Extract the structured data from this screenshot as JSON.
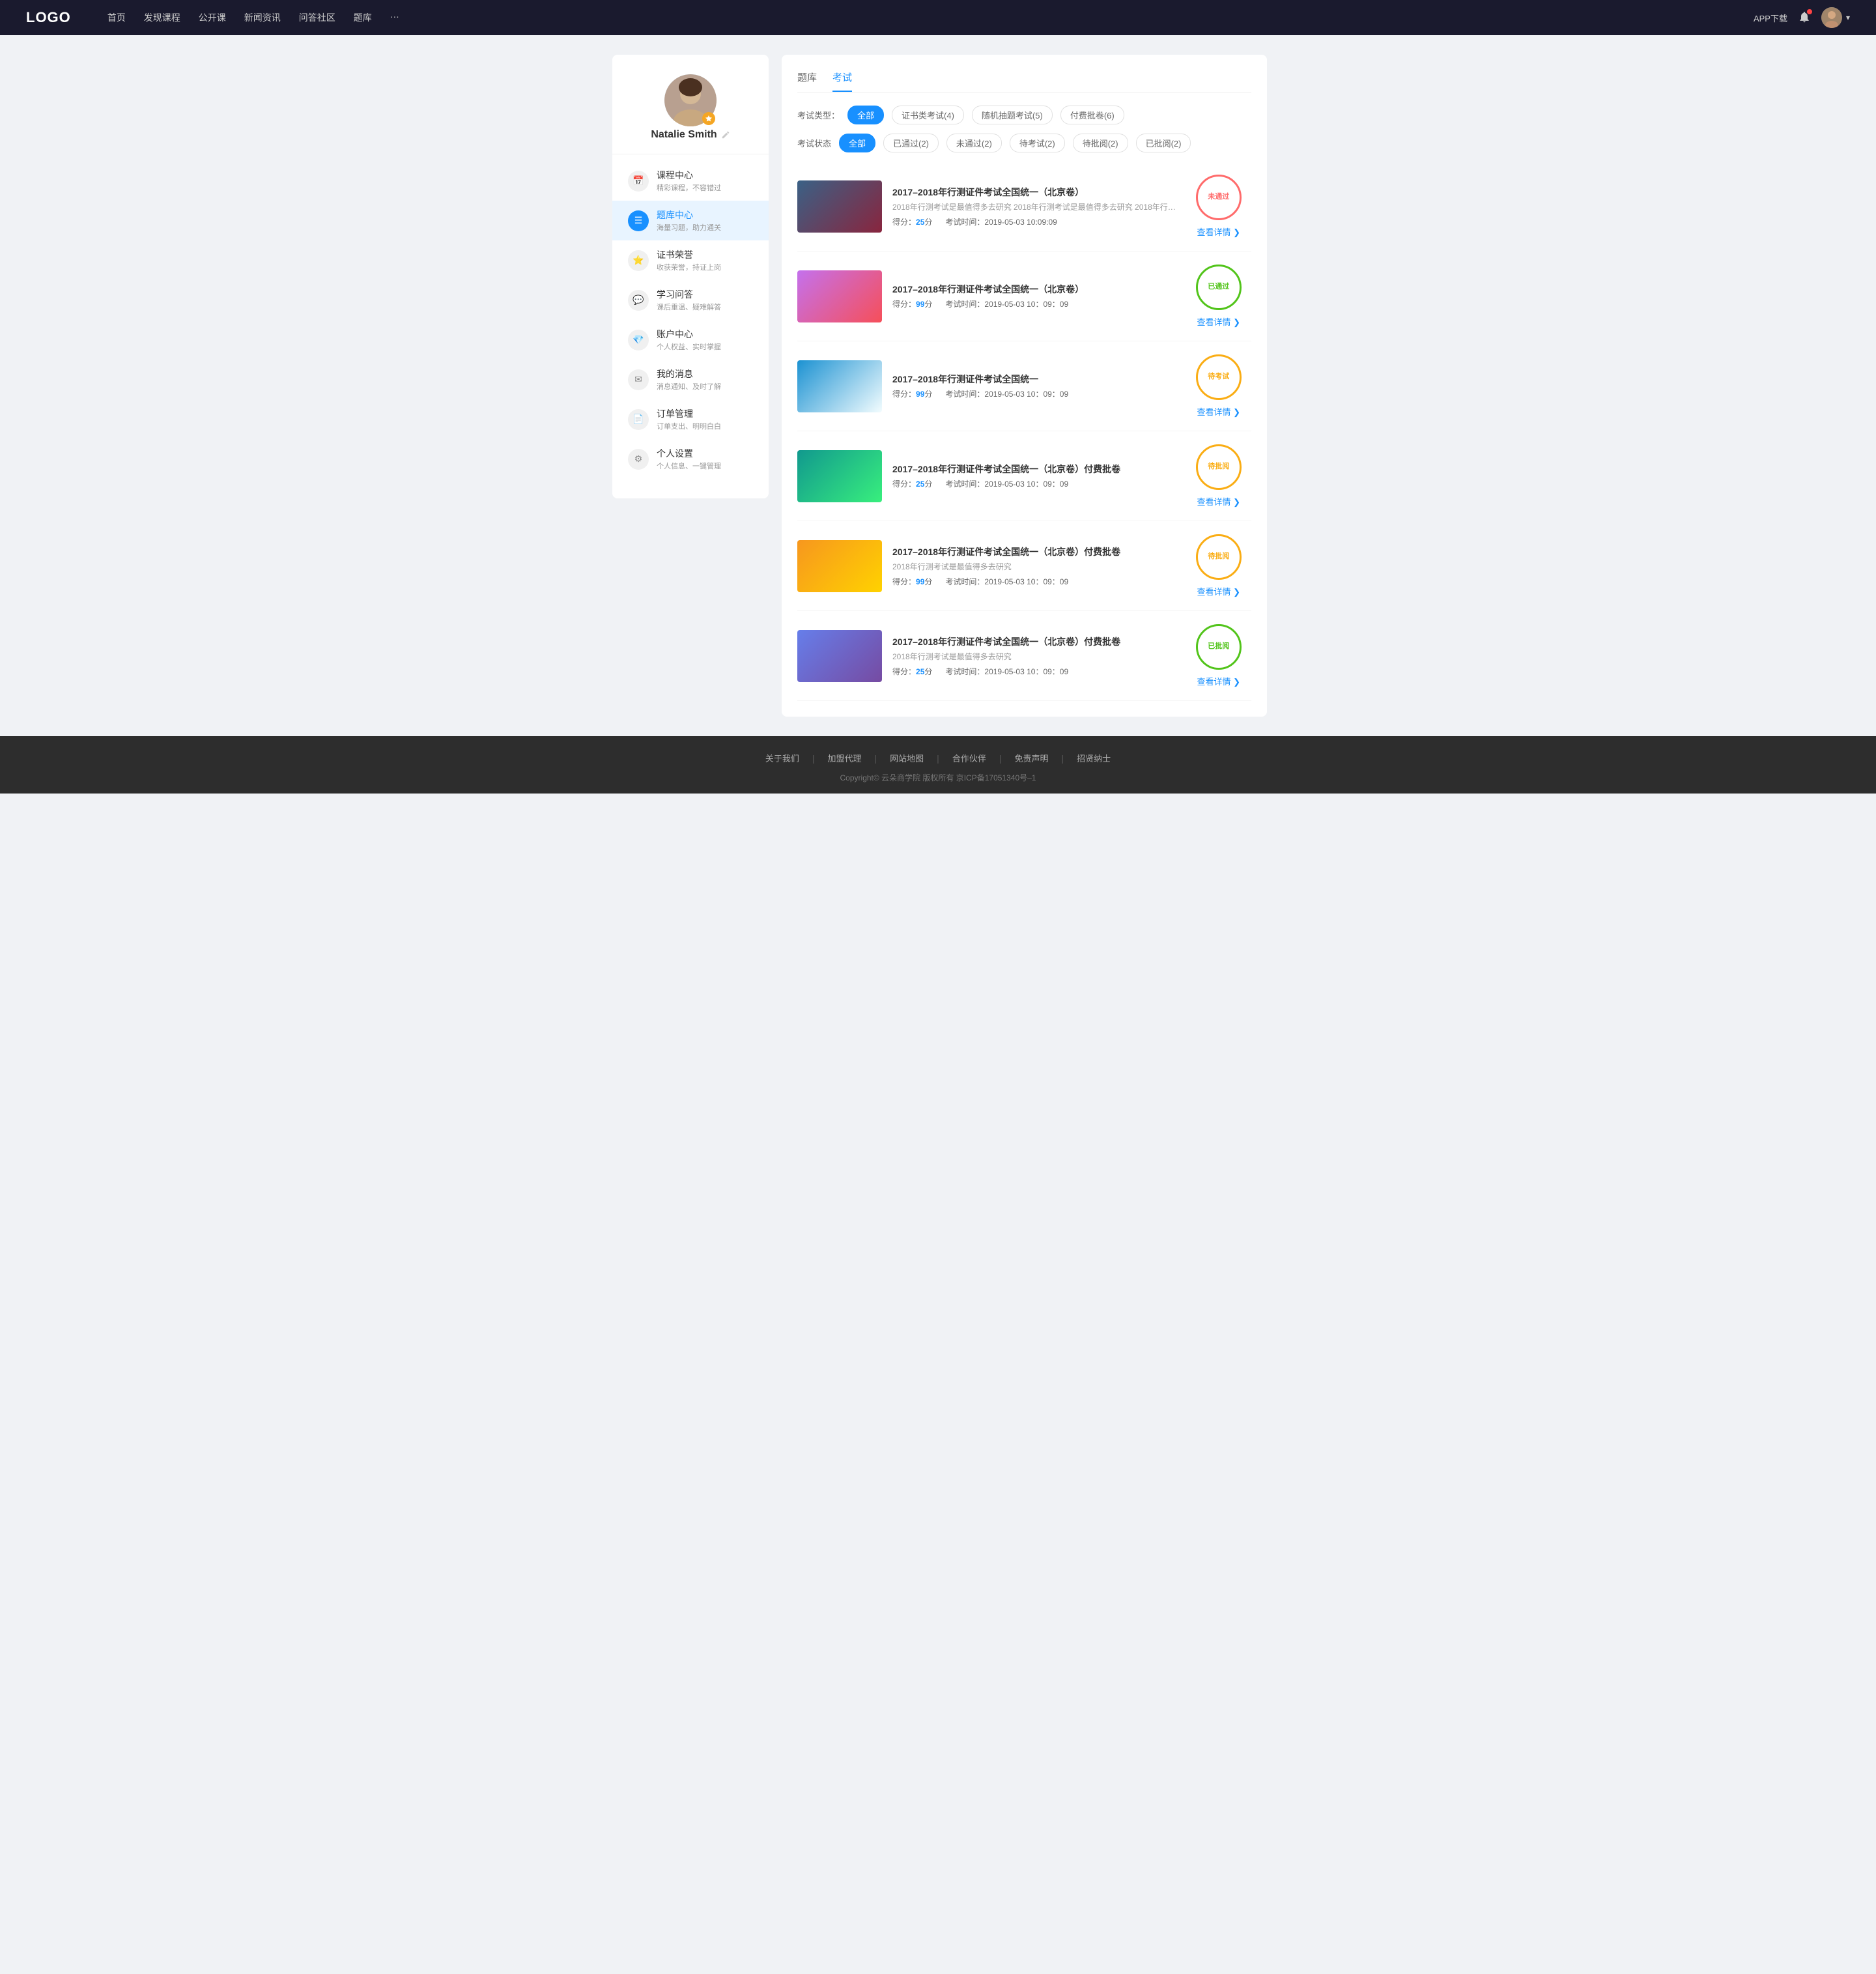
{
  "header": {
    "logo": "LOGO",
    "nav": [
      {
        "label": "首页",
        "href": "#"
      },
      {
        "label": "发现课程",
        "href": "#"
      },
      {
        "label": "公开课",
        "href": "#"
      },
      {
        "label": "新闻资讯",
        "href": "#"
      },
      {
        "label": "问答社区",
        "href": "#"
      },
      {
        "label": "题库",
        "href": "#"
      },
      {
        "label": "···",
        "href": "#"
      }
    ],
    "app_download": "APP下载"
  },
  "sidebar": {
    "user": {
      "name": "Natalie Smith",
      "edit_icon": "edit"
    },
    "menu": [
      {
        "id": "course",
        "icon": "📅",
        "title": "课程中心",
        "subtitle": "精彩课程，不容错过",
        "active": false
      },
      {
        "id": "question-bank",
        "icon": "📋",
        "title": "题库中心",
        "subtitle": "海量习题，助力通关",
        "active": true
      },
      {
        "id": "certificate",
        "icon": "🏅",
        "title": "证书荣誉",
        "subtitle": "收获荣誉，持证上岗",
        "active": false
      },
      {
        "id": "qa",
        "icon": "💬",
        "title": "学习问答",
        "subtitle": "课后重温、疑难解答",
        "active": false
      },
      {
        "id": "account",
        "icon": "💎",
        "title": "账户中心",
        "subtitle": "个人权益、实时掌握",
        "active": false
      },
      {
        "id": "message",
        "icon": "💬",
        "title": "我的消息",
        "subtitle": "消息通知、及时了解",
        "active": false
      },
      {
        "id": "order",
        "icon": "📄",
        "title": "订单管理",
        "subtitle": "订单支出、明明白白",
        "active": false
      },
      {
        "id": "settings",
        "icon": "⚙️",
        "title": "个人设置",
        "subtitle": "个人信息、一键管理",
        "active": false
      }
    ]
  },
  "content": {
    "tabs": [
      {
        "label": "题库",
        "active": false
      },
      {
        "label": "考试",
        "active": true
      }
    ],
    "filter_type": {
      "label": "考试类型：",
      "options": [
        {
          "label": "全部",
          "active": true
        },
        {
          "label": "证书类考试(4)",
          "active": false
        },
        {
          "label": "随机抽题考试(5)",
          "active": false
        },
        {
          "label": "付费批卷(6)",
          "active": false
        }
      ]
    },
    "filter_status": {
      "label": "考试状态",
      "options": [
        {
          "label": "全部",
          "active": true
        },
        {
          "label": "已通过(2)",
          "active": false
        },
        {
          "label": "未通过(2)",
          "active": false
        },
        {
          "label": "待考试(2)",
          "active": false
        },
        {
          "label": "待批阅(2)",
          "active": false
        },
        {
          "label": "已批阅(2)",
          "active": false
        }
      ]
    },
    "exams": [
      {
        "id": 1,
        "title": "2017–2018年行测证件考试全国统一（北京卷）",
        "desc": "2018年行测考试是最值得多去研究 2018年行测考试是最值得多去研究 2018年行…",
        "score_label": "得分：",
        "score": "25",
        "score_suffix": "分",
        "time_label": "考试时间：",
        "time": "2019-05-03  10:09:09",
        "status": "未通过",
        "status_type": "fail",
        "thumb_class": "thumb-1",
        "detail_label": "查看详情"
      },
      {
        "id": 2,
        "title": "2017–2018年行测证件考试全国统一（北京卷）",
        "desc": "",
        "score_label": "得分：",
        "score": "99",
        "score_suffix": "分",
        "time_label": "考试时间：",
        "time": "2019-05-03  10：09：09",
        "status": "已通过",
        "status_type": "pass",
        "thumb_class": "thumb-2",
        "detail_label": "查看详情"
      },
      {
        "id": 3,
        "title": "2017–2018年行测证件考试全国统一",
        "desc": "",
        "score_label": "得分：",
        "score": "99",
        "score_suffix": "分",
        "time_label": "考试时间：",
        "time": "2019-05-03  10：09：09",
        "status": "待考试",
        "status_type": "pending",
        "thumb_class": "thumb-3",
        "detail_label": "查看详情"
      },
      {
        "id": 4,
        "title": "2017–2018年行测证件考试全国统一（北京卷）付费批卷",
        "desc": "",
        "score_label": "得分：",
        "score": "25",
        "score_suffix": "分",
        "time_label": "考试时间：",
        "time": "2019-05-03  10：09：09",
        "status": "待批阅",
        "status_type": "pending",
        "thumb_class": "thumb-4",
        "detail_label": "查看详情"
      },
      {
        "id": 5,
        "title": "2017–2018年行测证件考试全国统一（北京卷）付费批卷",
        "desc": "2018年行测考试是最值得多去研究",
        "score_label": "得分：",
        "score": "99",
        "score_suffix": "分",
        "time_label": "考试时间：",
        "time": "2019-05-03  10：09：09",
        "status": "待批阅",
        "status_type": "pending",
        "thumb_class": "thumb-5",
        "detail_label": "查看详情"
      },
      {
        "id": 6,
        "title": "2017–2018年行测证件考试全国统一（北京卷）付费批卷",
        "desc": "2018年行测考试是最值得多去研究",
        "score_label": "得分：",
        "score": "25",
        "score_suffix": "分",
        "time_label": "考试时间：",
        "time": "2019-05-03  10：09：09",
        "status": "已批阅",
        "status_type": "reviewed",
        "thumb_class": "thumb-6",
        "detail_label": "查看详情"
      }
    ]
  },
  "footer": {
    "links": [
      "关于我们",
      "加盟代理",
      "网站地图",
      "合作伙伴",
      "免责声明",
      "招贤纳士"
    ],
    "copyright": "Copyright© 云朵商学院  版权所有    京ICP备17051340号–1"
  }
}
